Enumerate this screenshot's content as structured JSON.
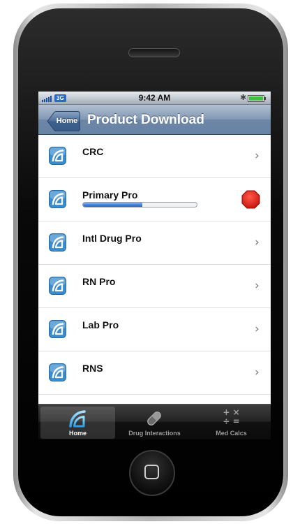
{
  "status_bar": {
    "network": "3G",
    "time": "9:42 AM",
    "bluetooth_icon": "bluetooth-icon",
    "battery_level": 1.0
  },
  "nav_bar": {
    "back_label": "Home",
    "title": "Product Download"
  },
  "products": [
    {
      "name": "CRC",
      "state": "available"
    },
    {
      "name": "Primary Pro",
      "state": "downloading",
      "progress": 0.52
    },
    {
      "name": "Intl Drug Pro",
      "state": "available"
    },
    {
      "name": "RN Pro",
      "state": "available"
    },
    {
      "name": "Lab Pro",
      "state": "available"
    },
    {
      "name": "RNS",
      "state": "available"
    }
  ],
  "tabs": [
    {
      "label": "Home",
      "icon": "epocrates-logo-icon",
      "active": true
    },
    {
      "label": "Drug Interactions",
      "icon": "pill-icon",
      "active": false
    },
    {
      "label": "Med Calcs",
      "icon": "calculator-icon",
      "active": false
    }
  ],
  "colors": {
    "nav_bar": "#6d86a7",
    "progress_fill": "#3f7fdc",
    "stop_button": "#e3221c",
    "app_icon": "#3b8ccc",
    "tab_bar": "#1a1a1a"
  }
}
